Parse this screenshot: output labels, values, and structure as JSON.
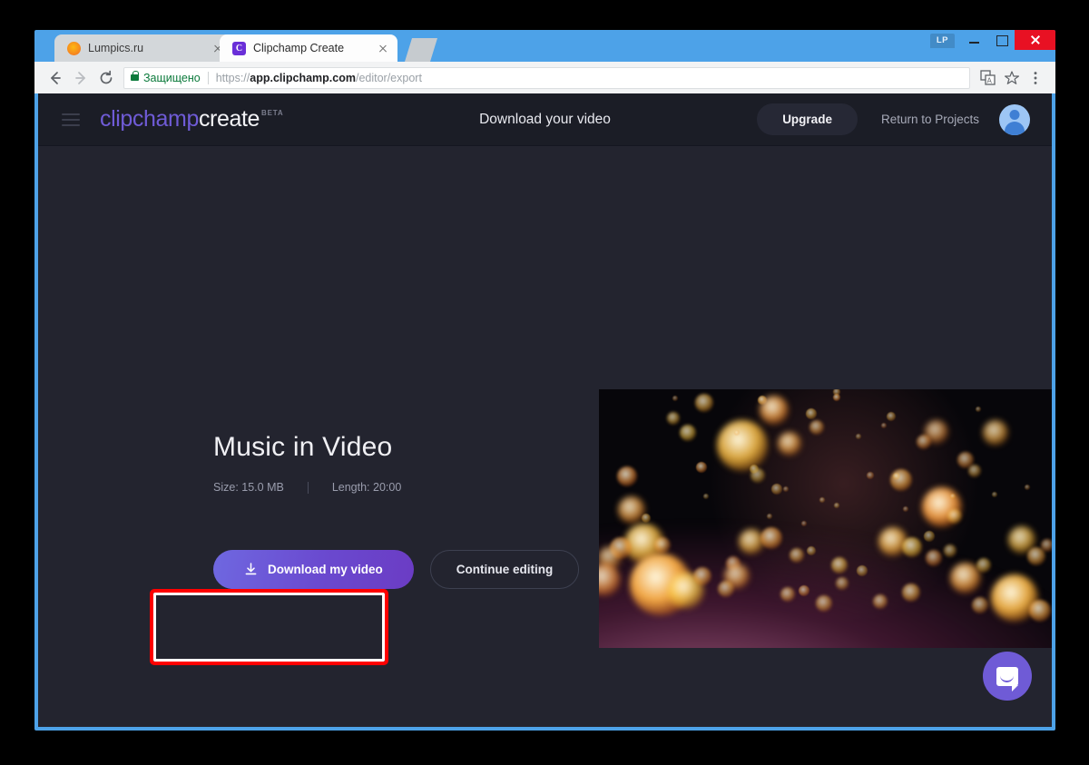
{
  "browser": {
    "tabs": [
      {
        "title": "Lumpics.ru",
        "favicon": "lumpics-favicon",
        "active": false
      },
      {
        "title": "Clipchamp Create",
        "favicon": "clipchamp-favicon",
        "favicon_letter": "C",
        "active": true
      }
    ],
    "new_tab_label": "",
    "profile_badge": "LP",
    "omnibox": {
      "security_label": "Защищено",
      "url_scheme": "https://",
      "url_host": "app.clipchamp.com",
      "url_path": "/editor/export"
    }
  },
  "app": {
    "logo": {
      "part1": "clipchamp",
      "part2": "create",
      "badge": "BETA"
    },
    "header": {
      "title": "Download your video",
      "upgrade_label": "Upgrade",
      "return_label": "Return to Projects"
    },
    "export": {
      "video_title": "Music in Video",
      "size_label": "Size: 15.0 MB",
      "length_label": "Length: 20:00",
      "download_label": "Download my video",
      "continue_label": "Continue editing"
    },
    "colors": {
      "accent_purple": "#6f5bd6",
      "button_gradient_start": "#6f68e0",
      "button_gradient_end": "#6b3cc4",
      "page_background": "#23242f",
      "header_background": "#1b1d26",
      "annotation_red": "#fe0000",
      "secure_green": "#0b7a3b",
      "chrome_frame_blue": "#4da2e8"
    }
  }
}
